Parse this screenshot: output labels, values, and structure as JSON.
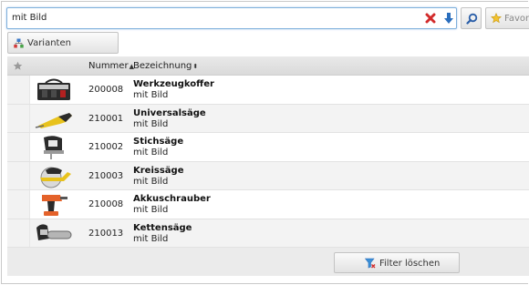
{
  "search": {
    "value": "mit Bild"
  },
  "toolbar": {
    "favorites_label": "Favor",
    "variants_label": "Varianten"
  },
  "table": {
    "columns": {
      "nummer": "Nummer",
      "bezeichnung": "Bezeichnung"
    },
    "rows": [
      {
        "nummer": "200008",
        "title": "Werkzeugkoffer",
        "subtitle": "mit Bild",
        "thumb": "toolbox-image"
      },
      {
        "nummer": "210001",
        "title": "Universalsäge",
        "subtitle": "mit Bild",
        "thumb": "saber-saw-image"
      },
      {
        "nummer": "210002",
        "title": "Stichsäge",
        "subtitle": "mit Bild",
        "thumb": "jigsaw-image"
      },
      {
        "nummer": "210003",
        "title": "Kreissäge",
        "subtitle": "mit Bild",
        "thumb": "circular-saw-image"
      },
      {
        "nummer": "210008",
        "title": "Akkuschrauber",
        "subtitle": "mit Bild",
        "thumb": "cordless-drill-image"
      },
      {
        "nummer": "210013",
        "title": "Kettensäge",
        "subtitle": "mit Bild",
        "thumb": "chainsaw-image"
      }
    ]
  },
  "footer": {
    "clear_filter_label": "Filter löschen"
  },
  "colors": {
    "accent_blue": "#2a6ebd",
    "clear_red": "#d22b2b",
    "tool_yellow": "#e8c21c",
    "tool_orange": "#e4622a"
  }
}
